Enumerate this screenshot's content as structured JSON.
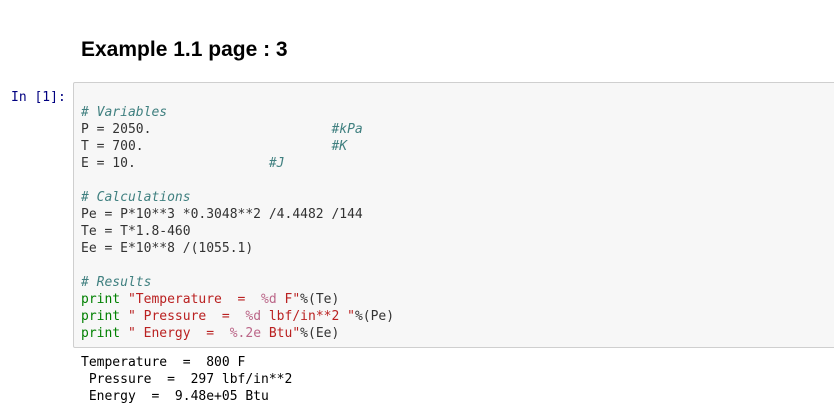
{
  "heading": "Example 1.1 page : 3",
  "cell": {
    "prompt": "In [1]:",
    "code": [
      [
        [
          "comment",
          "# Variables"
        ]
      ],
      [
        [
          "plain",
          "P = 2050.                       "
        ],
        [
          "comment",
          "#kPa"
        ]
      ],
      [
        [
          "plain",
          "T = 700.                        "
        ],
        [
          "comment",
          "#K"
        ]
      ],
      [
        [
          "plain",
          "E = 10.                 "
        ],
        [
          "comment",
          "#J"
        ]
      ],
      [],
      [
        [
          "comment",
          "# Calculations"
        ]
      ],
      [
        [
          "plain",
          "Pe = P*10**3 *0.3048**2 /4.4482 /144"
        ]
      ],
      [
        [
          "plain",
          "Te = T*1.8-460"
        ]
      ],
      [
        [
          "plain",
          "Ee = E*10**8 /(1055.1)"
        ]
      ],
      [],
      [
        [
          "comment",
          "# Results"
        ]
      ],
      [
        [
          "keyword",
          "print"
        ],
        [
          "plain",
          " "
        ],
        [
          "string",
          "\"Temperature  =  "
        ],
        [
          "interp",
          "%d"
        ],
        [
          "string",
          " F\""
        ],
        [
          "plain",
          "%(Te)"
        ]
      ],
      [
        [
          "keyword",
          "print"
        ],
        [
          "plain",
          " "
        ],
        [
          "string",
          "\" Pressure  =  "
        ],
        [
          "interp",
          "%d"
        ],
        [
          "string",
          " lbf/in**2 \""
        ],
        [
          "plain",
          "%(Pe)"
        ]
      ],
      [
        [
          "keyword",
          "print"
        ],
        [
          "plain",
          " "
        ],
        [
          "string",
          "\" Energy  =  "
        ],
        [
          "interp",
          "%.2e"
        ],
        [
          "string",
          " Btu\""
        ],
        [
          "plain",
          "%(Ee)"
        ]
      ]
    ],
    "output": [
      "Temperature  =  800 F",
      " Pressure  =  297 lbf/in**2",
      " Energy  =  9.48e+05 Btu"
    ]
  }
}
